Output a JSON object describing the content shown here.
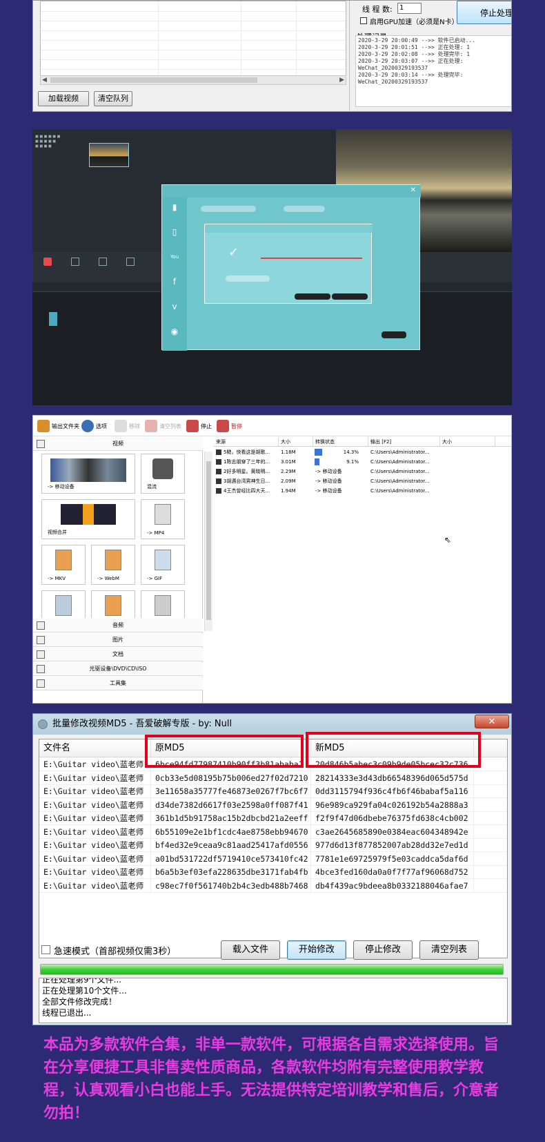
{
  "panel1": {
    "thread_label": "线 程 数:",
    "thread_value": "1",
    "gpu_label": "启用GPU加速（必须是N卡）",
    "stop_button": "停止处理",
    "log_title": "处理记录:",
    "log_lines": [
      "2020-3-29 20:00:49 -->> 软件已启动...",
      "2020-3-29 20:01:51 -->> 正在处理: 1",
      "2020-3-29 20:02:08 -->> 处理完毕: 1",
      "2020-3-29 20:03:07 -->> 正在处理:",
      "WeChat_20200329193537",
      "2020-3-29 20:03:14 -->> 处理完毕:",
      "WeChat_20200329193537"
    ],
    "load_button": "加载视频",
    "clear_button": "清空队列"
  },
  "panel3": {
    "toolbar": [
      "输出文件夹",
      "选项",
      "移除",
      "清空列表",
      "停止",
      "暂停"
    ],
    "categories": [
      "视频",
      "音频",
      "图片",
      "文档",
      "光驱设备\\DVD\\CD\\ISO",
      "工具集"
    ],
    "tiles": [
      "-> 移动设备",
      "混流",
      "视频合并",
      "-> MP4",
      "-> MKV",
      "-> WebM",
      "-> GIF"
    ],
    "columns": [
      "来源",
      "大小",
      "转换状态",
      "输出 [F2]",
      "大小"
    ],
    "rows": [
      {
        "name": "5糙，快看这是胡歌...",
        "size": "1.18M",
        "status": "14.3%",
        "progress": 0.143,
        "output": "C:\\Users\\Administrator..."
      },
      {
        "name": "1陈志朋穿了三年的...",
        "size": "3.01M",
        "status": "9.1%",
        "progress": 0.091,
        "output": "C:\\Users\\Administrator..."
      },
      {
        "name": "2好多明星。黄晓明...",
        "size": "2.29M",
        "status": "-> 移动设备",
        "progress": 0,
        "output": "C:\\Users\\Administrator..."
      },
      {
        "name": "3胡遇台湾男神生日...",
        "size": "2.09M",
        "status": "-> 移动设备",
        "progress": 0,
        "output": "C:\\Users\\Administrator..."
      },
      {
        "name": "4王杰曾经比四大天...",
        "size": "1.94M",
        "status": "-> 移动设备",
        "progress": 0,
        "output": "C:\\Users\\Administrator..."
      }
    ]
  },
  "panel4": {
    "title": "批量修改视频MD5 - 吾爱破解专版 - by: Null",
    "close": "✕",
    "columns": [
      "文件名",
      "原MD5",
      "新MD5"
    ],
    "rows": [
      {
        "file": "E:\\Guitar video\\蓝老师",
        "old": "6bce94fd77987410b90ff3b81ababa1",
        "new": "20d846b5abec3c09b9de05bcec32c736"
      },
      {
        "file": "E:\\Guitar video\\蓝老师",
        "old": "0cb33e5d08195b75b006ed27f02d7210",
        "new": "28214333e3d43db66548396d065d575d"
      },
      {
        "file": "E:\\Guitar video\\蓝老师",
        "old": "3e11658a35777fe46873e0267f7bc6f7",
        "new": "0dd3115794f936c4fb6f46babaf5a116"
      },
      {
        "file": "E:\\Guitar video\\蓝老师",
        "old": "d34de7382d6617f03e2598a0ff087f41",
        "new": "96e989ca929fa04c026192b54a2888a3"
      },
      {
        "file": "E:\\Guitar video\\蓝老师",
        "old": "361b1d5b91758ac15b2dbcbd21a2eeff",
        "new": "f2f9f47d06dbebe76375fd638c4cb002"
      },
      {
        "file": "E:\\Guitar video\\蓝老师",
        "old": "6b55109e2e1bf1cdc4ae8758ebb94670",
        "new": "c3ae2645685890e0384eac604348942e"
      },
      {
        "file": "E:\\Guitar video\\蓝老师",
        "old": "bf4ed32e9ceaa9c81aad25417afd0556",
        "new": "977d6d13f877852007ab28dd32e7ed1d"
      },
      {
        "file": "E:\\Guitar video\\蓝老师",
        "old": "a01bd531722df5719410ce573410fc42",
        "new": "7781e1e69725979f5e03caddca5daf6d"
      },
      {
        "file": "E:\\Guitar video\\蓝老师",
        "old": "b6a5b3ef03efa228635dbe3171fab4fb",
        "new": "4bce3fed160da0a0f7f77af96068d752"
      },
      {
        "file": "E:\\Guitar video\\蓝老师",
        "old": "c98ec7f0f561740b2b4c3edb488b7468",
        "new": "db4f439ac9bdeea8b0332188046afae7"
      }
    ],
    "fast_mode": "急速模式（首部视频仅需3秒）",
    "btn_load": "载入文件",
    "btn_start": "开始修改",
    "btn_stop": "停止修改",
    "btn_clear": "清空列表",
    "progress": 1.0,
    "log_lines": [
      "正在处理第9个文件...",
      "正在处理第10个文件...",
      "全部文件修改完成！",
      "线程已退出..."
    ]
  },
  "footer_text": "本品为多款软件合集，非单一款软件，可根据各自需求选择使用。旨在分享便捷工具非售卖性质商品，各款软件均附有完整使用教学教程，认真观看小白也能上手。无法提供特定培训教学和售后，介意者勿拍！",
  "colors": {
    "background": "#2d2a74",
    "footer": "#e93ce0",
    "highlight": "#e3001b",
    "progress": "#3fd13a"
  }
}
